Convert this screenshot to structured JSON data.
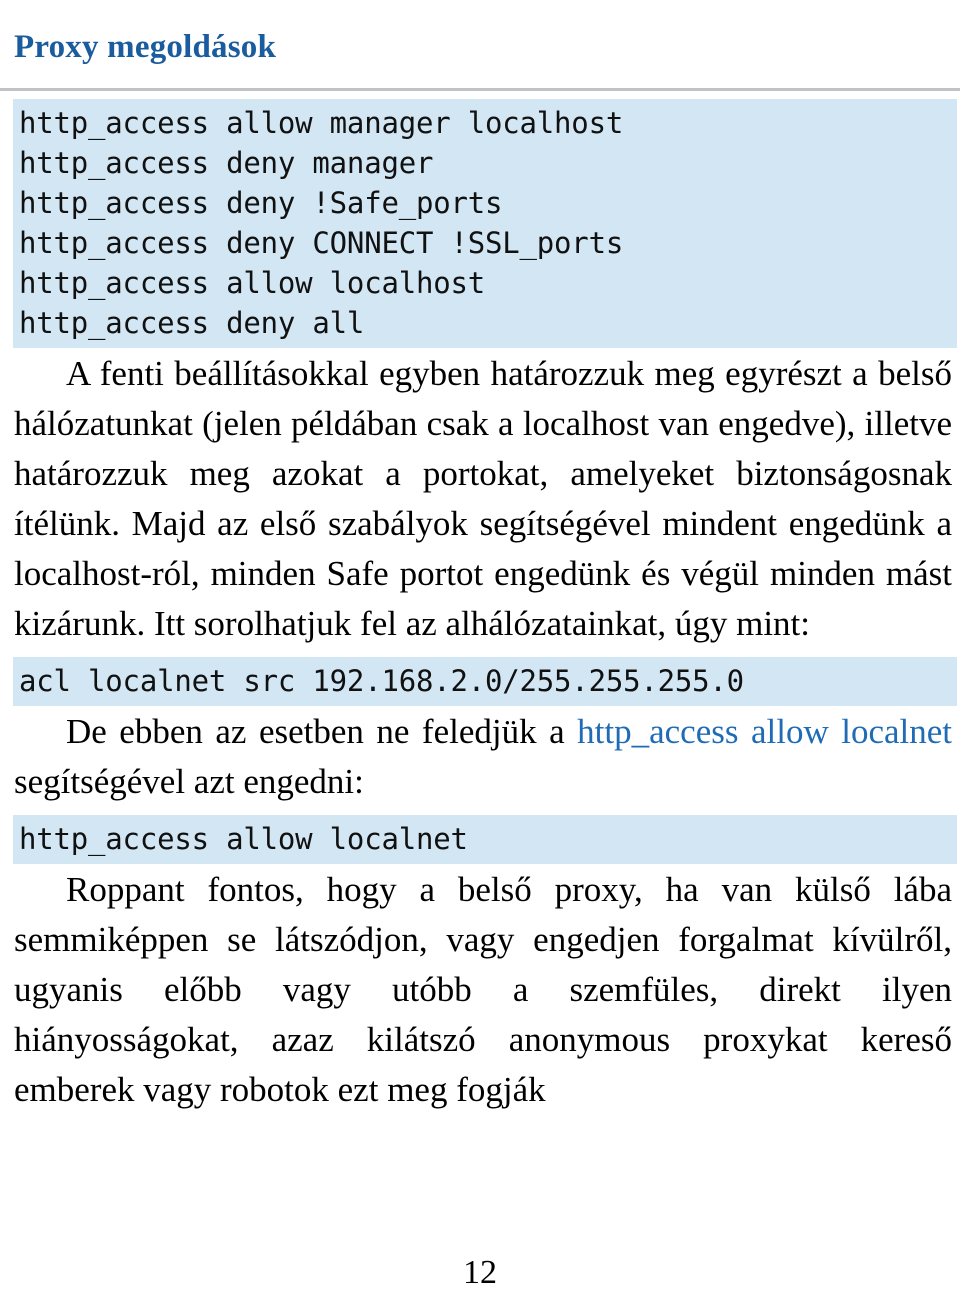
{
  "document": {
    "section_title": "Proxy megoldások",
    "page_number": "12"
  },
  "code_block_1": {
    "lines": [
      "http_access allow manager localhost",
      "http_access deny manager",
      "http_access deny !Safe_ports",
      "http_access deny CONNECT !SSL_ports",
      "http_access allow localhost",
      "http_access deny all"
    ]
  },
  "paragraph_1": {
    "text": "A fenti beállításokkal egyben határozzuk meg egyrészt a belső hálózatunkat (jelen példában csak a localhost van engedve), illetve határozzuk meg azokat a portokat, amelyeket biztonságosnak ítélünk. Majd az első szabályok segítségével mindent engedünk a localhost-ról, minden Safe portot engedünk és végül minden mást kizárunk. Itt sorolhatjuk fel az alhálózatainkat, úgy mint:"
  },
  "code_block_2": {
    "lines": [
      "acl localnet src 192.168.2.0/255.255.255.0"
    ]
  },
  "paragraph_2": {
    "prefix": "De ebben az esetben ne feledjük  a ",
    "highlight": "http_access allow localnet",
    "suffix": " segítségével azt engedni:"
  },
  "code_block_3": {
    "lines": [
      "http_access allow localnet"
    ]
  },
  "paragraph_3": {
    "text": "Roppant fontos, hogy a belső proxy, ha van külső lába semmiképpen se látszódjon, vagy engedjen forgalmat kívülről, ugyanis előbb vagy utóbb a szemfüles, direkt ilyen hiányosságokat, azaz kilátszó anonymous proxykat kereső emberek vagy robotok ezt meg fogják"
  },
  "colors": {
    "title_blue": "#1a5c9e",
    "link_blue": "#1f6bb5",
    "code_background": "#d2e6f3",
    "rule_gray": "#bfc3c6"
  }
}
